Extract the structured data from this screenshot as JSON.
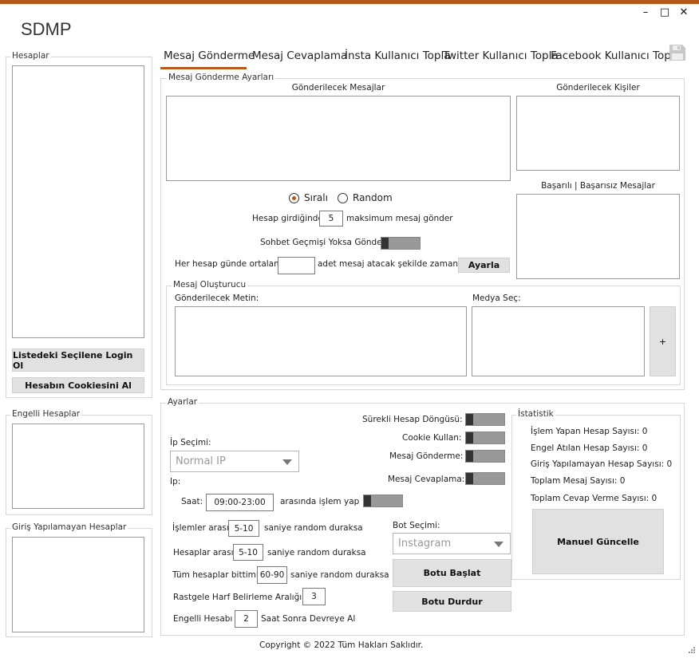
{
  "app": {
    "title": "SDMP"
  },
  "window": {
    "minimize": "–",
    "maximize": "□",
    "close": "✕"
  },
  "left": {
    "accounts_title": "Hesaplar",
    "login_button": "Listedeki Seçilene Login Ol",
    "cookie_button": "Hesabın Cookiesini Al",
    "blocked_title": "Engelli Hesaplar",
    "failed_title": "Giriş Yapılamayan Hesaplar"
  },
  "tabs": [
    "Mesaj Gönderme",
    "Mesaj Cevaplama",
    "İnsta Kullanıcı Topla",
    "Twitter Kullanıcı Topla",
    "Facebook Kullanıcı Topla"
  ],
  "send_settings": {
    "title": "Mesaj Gönderme Ayarları",
    "messages_label": "Gönderilecek Mesajlar",
    "recipients_label": "Gönderilecek Kişiler",
    "success_label": "Başarılı | Başarısız Mesajlar",
    "radio_ordered": "Sıralı",
    "radio_random": "Random",
    "max_prefix": "Hesap girdiğinde",
    "max_value": "5",
    "max_suffix": "maksimum mesaj gönder",
    "history_label": "Sohbet Geçmişi Yoksa Gönder:",
    "avg_prefix": "Her hesap günde ortalama",
    "avg_value": "",
    "avg_suffix": "adet mesaj atacak şekilde zamanları",
    "adjust_button": "Ayarla"
  },
  "creator": {
    "title": "Mesaj Oluşturucu",
    "text_label": "Gönderilecek Metin:",
    "media_label": "Medya Seç:",
    "add_button": "+"
  },
  "settings": {
    "title": "Ayarlar",
    "loop_label": "Sürekli Hesap Döngüsü:",
    "cookie_label": "Cookie Kullan:",
    "send_label": "Mesaj Gönderme:",
    "reply_label": "Mesaj Cevaplama:",
    "ip_label": "İp Seçimi:",
    "ip_selected": "Normal IP",
    "ip_short": "Ip:",
    "time_label": "Saat:",
    "time_value": "09:00-23:00",
    "time_suffix": "arasında işlem yap",
    "ops_prefix": "İşlemler arası",
    "ops_value": "5-10",
    "ops_suffix": "saniye random duraksa",
    "acc_prefix": "Hesaplar arası",
    "acc_value": "5-10",
    "acc_suffix": "saniye random duraksa",
    "all_prefix": "Tüm hesaplar bittimi",
    "all_value": "60-90",
    "all_suffix": "saniye random duraksa",
    "rand_prefix": "Rastgele Harf Belirleme Aralığı:",
    "rand_value": "3",
    "blocked_prefix": "Engelli Hesabı",
    "blocked_value": "2",
    "blocked_suffix": "Saat Sonra Devreye Al",
    "bot_label": "Bot Seçimi:",
    "bot_selected": "Instagram",
    "start_button": "Botu Başlat",
    "stop_button": "Botu Durdur"
  },
  "stats": {
    "title": "İstatistik",
    "processed": "İşlem Yapan Hesap Sayısı: 0",
    "blocked": "Engel Atılan Hesap Sayısı: 0",
    "failed_login": "Giriş Yapılamayan Hesap Sayısı: 0",
    "total_messages": "Toplam Mesaj Sayısı: 0",
    "total_replies": "Toplam Cevap Verme Sayısı: 0",
    "refresh_button": "Manuel Güncelle"
  },
  "footer": {
    "copyright": "Copyright © 2022 Tüm Hakları Saklıdır."
  }
}
